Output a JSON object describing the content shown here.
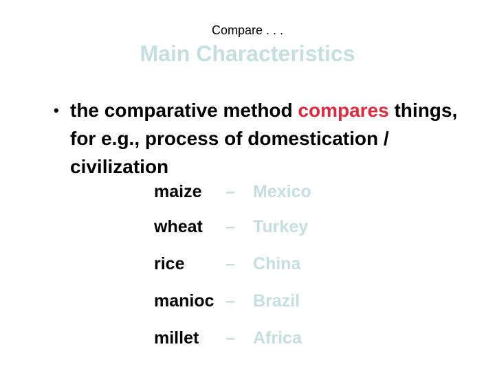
{
  "slide": {
    "pre_title": "Compare . . .",
    "title": "Main Characteristics",
    "bullet": {
      "symbol": "•",
      "text_before": "the comparative method ",
      "highlight": "compares",
      "text_after": " things, for e.g., process of domestication / civilization"
    },
    "dash": "–",
    "pairs": [
      {
        "crop": "maize",
        "place": "Mexico"
      },
      {
        "crop": "wheat",
        "place": "Turkey"
      },
      {
        "crop": "rice",
        "place": "China"
      },
      {
        "crop": "manioc",
        "place": "Brazil"
      },
      {
        "crop": "millet",
        "place": "Africa"
      }
    ],
    "colors": {
      "title": "#c5dfe1",
      "highlight": "#e0283e",
      "text": "#000000"
    }
  }
}
